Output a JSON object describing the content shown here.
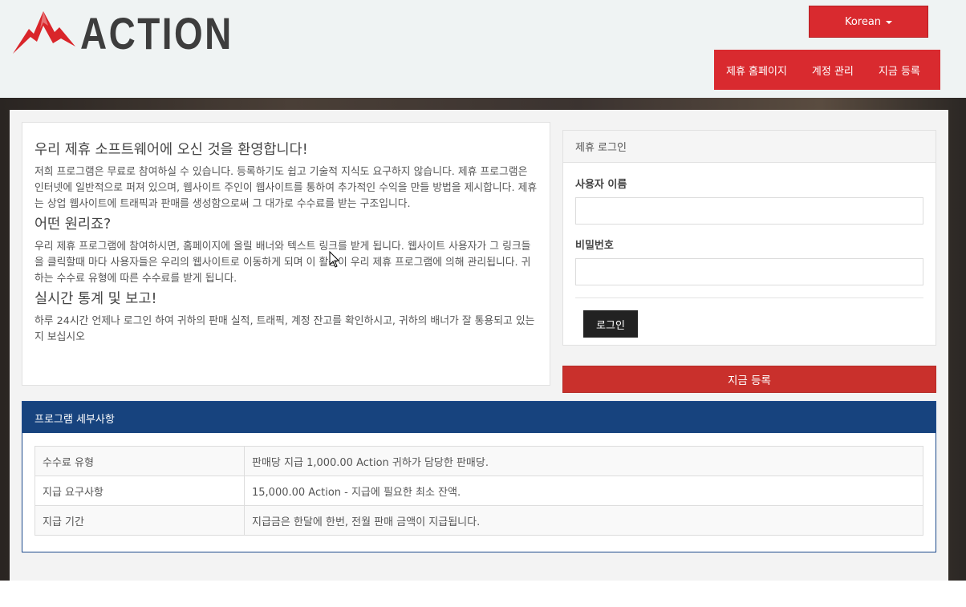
{
  "header": {
    "logo_text": "ACTION",
    "language_label": "Korean",
    "nav": [
      "제휴 홈페이지",
      "계정 관리",
      "지금 등록"
    ]
  },
  "welcome": {
    "title": "우리 제휴 소프트웨어에 오신 것을 환영합니다!",
    "intro": "저희 프로그램은 무료로 참여하실 수 있습니다. 등록하기도 쉽고 기술적 지식도 요구하지 않습니다. 제휴 프로그램은 인터넷에 일반적으로 퍼져 있으며, 웹사이트 주인이 웹사이트를 통하여 추가적인 수익을 만들 방법을 제시합니다. 제휴는 상업 웹사이트에 트래픽과 판매를 생성함으로써 그 대가로 수수료를 받는 구조입니다.",
    "how_title": "어떤 원리죠?",
    "how_text": "우리 제휴 프로그램에 참여하시면, 홈페이지에 올릴 배너와 텍스트 링크를 받게 됩니다. 웹사이트 사용자가 그 링크들을 클릭할때 마다 사용자들은 우리의 웹사이트로 이동하게 되며 이 활동이 우리 제휴 프로그램에 의해 관리됩니다. 귀하는 수수료 유형에 따른 수수료를 받게 됩니다.",
    "stats_title": "실시간 통계 및 보고!",
    "stats_text": "하루 24시간 언제나 로그인 하여 귀하의 판매 실적, 트래픽, 계정 잔고를 확인하시고, 귀하의 배너가 잘 통용되고 있는지 보십시오"
  },
  "login": {
    "title": "제휴 로그인",
    "username_label": "사용자 이름",
    "password_label": "비밀번호",
    "username_value": "",
    "password_value": "",
    "button_label": "로그인"
  },
  "signup_label": "지금 등록",
  "details": {
    "title": "프로그램 세부사항",
    "rows": [
      {
        "key": "수수료 유형",
        "value": "판매당 지급 1,000.00 Action 귀하가 담당한 판매당."
      },
      {
        "key": "지급 요구사항",
        "value": "15,000.00 Action - 지급에 필요한 최소 잔액."
      },
      {
        "key": "지급 기간",
        "value": "지급금은 한달에 한번, 전월 판매 금액이 지급됩니다."
      }
    ]
  },
  "colors": {
    "accent_red": "#d92a2f",
    "signup_red": "#c9302c",
    "details_blue": "#17437e"
  }
}
